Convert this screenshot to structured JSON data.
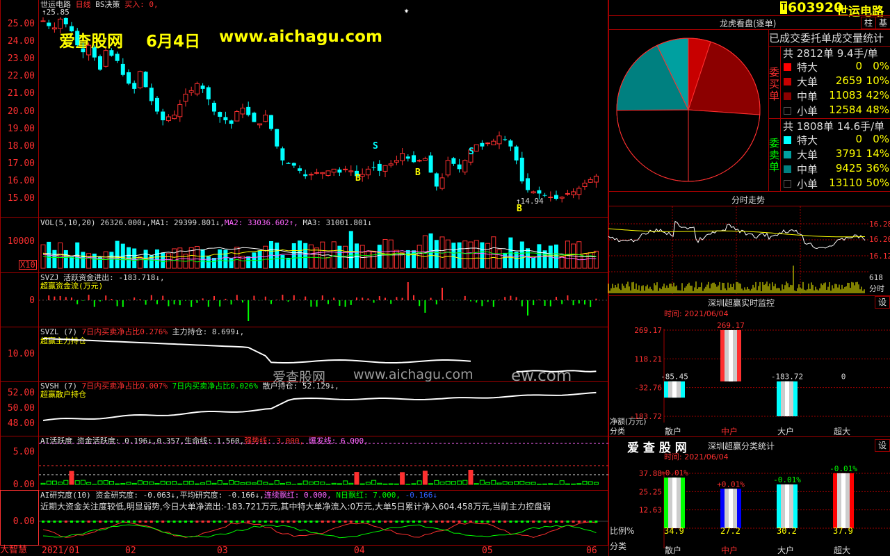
{
  "stock": {
    "title": "世运电路",
    "period": "日线",
    "strategy": "BS决策",
    "buy_label": "买入: 0,",
    "high_mark": "↑25.85",
    "low_mark": "↑14.94",
    "code": "603920",
    "name": "世运电路",
    "code_prefix": "T"
  },
  "watermark": {
    "site": "爱查股网",
    "date": "6月4日",
    "url": "www.aichagu.com",
    "mid_text": "爱查股网",
    "mid_url": "www.aichagu.com",
    "mid_tail": "ew.com"
  },
  "price_axis": [
    "25.00",
    "24.00",
    "23.00",
    "22.00",
    "21.00",
    "20.00",
    "19.00",
    "18.00",
    "17.00",
    "16.00",
    "15.00"
  ],
  "signals": {
    "s1": "S",
    "s2": "S",
    "b1": "B",
    "b2": "B",
    "b3": "B"
  },
  "vol": {
    "header": "VOL(5,10,20) 26326.000↓,MA1: 29399.801↓,",
    "ma2": "MA2: 33036.602↑,",
    "ma3": "MA3: 31001.801↓",
    "axis": "10000",
    "unit": "X10"
  },
  "svzj": {
    "header": "SVZJ  活跃资金进出: -183.718↓,",
    "sub": "超赢资金流(万元)",
    "axis": "0"
  },
  "svzl": {
    "header_a": "SVZL (7)",
    "header_b": "7日内买卖净占比0.276%",
    "header_c": "主力持仓: 8.699↓,",
    "sub": "超赢主力持仓",
    "axis": "10.00"
  },
  "svsh": {
    "header_a": "SVSH (7)",
    "header_b": "7日内买卖净占比0.007%",
    "header_c": "7日内买卖净占比0.026%",
    "header_d": "散户持仓: 52.129↓,",
    "sub": "超赢散户持仓",
    "axis": [
      "52.00",
      "50.00",
      "48.00"
    ]
  },
  "ai": {
    "header_a": "AI活跃度 资金活跃度: 0.196↓,0.357,生命线: 1.560,",
    "header_b": "强势线: 3.000,",
    "header_c": "爆发线: 6.000,",
    "axis": [
      "5.00",
      "0.00"
    ]
  },
  "research": {
    "header_a": "AI研究度(10) 资金研究度: -0.063↓,平均研究度: -0.166↓,",
    "header_b": "连续飘红: 0.000,",
    "header_c": "N日飘红: 7.000,",
    "header_d": "-0.166↓",
    "comment": "近期大资金关注度较低,明显弱势,今日大单净流出:-183.721万元,其中特大单净流入:0万元,大单5日累计净入604.458万元,当前主力控盘弱",
    "axis": "0.00"
  },
  "date_axis": [
    "2021/01",
    "02",
    "03",
    "04",
    "05",
    "06"
  ],
  "corner": "大智慧",
  "right": {
    "btn_zhu": "柱",
    "btn_ji": "基",
    "pie_title": "龙虎看盘(逐单)",
    "stat_title": "已成交委托单成交量统计",
    "buy": {
      "side": "委买单",
      "total": "共 2812单 9.4手/单",
      "rows": [
        {
          "name": "特大",
          "vol": "0",
          "pct": "0%",
          "color": "#ff0000"
        },
        {
          "name": "大单",
          "vol": "2659",
          "pct": "10%",
          "color": "#c80000"
        },
        {
          "name": "中单",
          "vol": "11083",
          "pct": "42%",
          "color": "#8c0000"
        },
        {
          "name": "小单",
          "vol": "12584",
          "pct": "48%",
          "color": "#000000"
        }
      ]
    },
    "sell": {
      "side": "委卖单",
      "total": "共 1808单 14.6手/单",
      "rows": [
        {
          "name": "特大",
          "vol": "0",
          "pct": "0%",
          "color": "#00ffff"
        },
        {
          "name": "大单",
          "vol": "3791",
          "pct": "14%",
          "color": "#00a0a0"
        },
        {
          "name": "中单",
          "vol": "9425",
          "pct": "36%",
          "color": "#008080"
        },
        {
          "name": "小单",
          "vol": "13110",
          "pct": "50%",
          "color": "#000000"
        }
      ]
    },
    "intraday_title": "分时走势",
    "intraday_axis": [
      "16.28",
      "16.20",
      "16.12"
    ],
    "intraday_vol": "618",
    "intraday_vol_unit": "分时",
    "monitor": {
      "title": "深圳超赢实时监控",
      "btn": "设",
      "time": "时间: 2021/06/04",
      "axis": [
        "269.17",
        "118.21",
        "-32.76",
        "-183.72"
      ],
      "values": [
        "-85.45",
        "269.17",
        "-183.72",
        "0"
      ],
      "unit": "净额(万元)",
      "cat_label": "分类",
      "cats": [
        "散户",
        "中户",
        "大户",
        "超大"
      ]
    },
    "stats": {
      "brand": "爱 查 股 网",
      "title": "深圳超赢分类统计",
      "btn": "设",
      "time": "时间: 2021/06/04",
      "axis": [
        "37.88",
        "25.25",
        "12.63"
      ],
      "changes": [
        "+0.01%",
        "+0.01%",
        "-0.01%",
        "-0.01%"
      ],
      "values": [
        "34.9",
        "27.2",
        "30.2",
        "37.9"
      ],
      "ratio_label": "比例%",
      "cat_label": "分类",
      "cats": [
        "散户",
        "中户",
        "大户",
        "超大"
      ],
      "colors": [
        "#00ff00",
        "#0000ff",
        "#00ffff",
        "#ff0000"
      ]
    }
  }
}
